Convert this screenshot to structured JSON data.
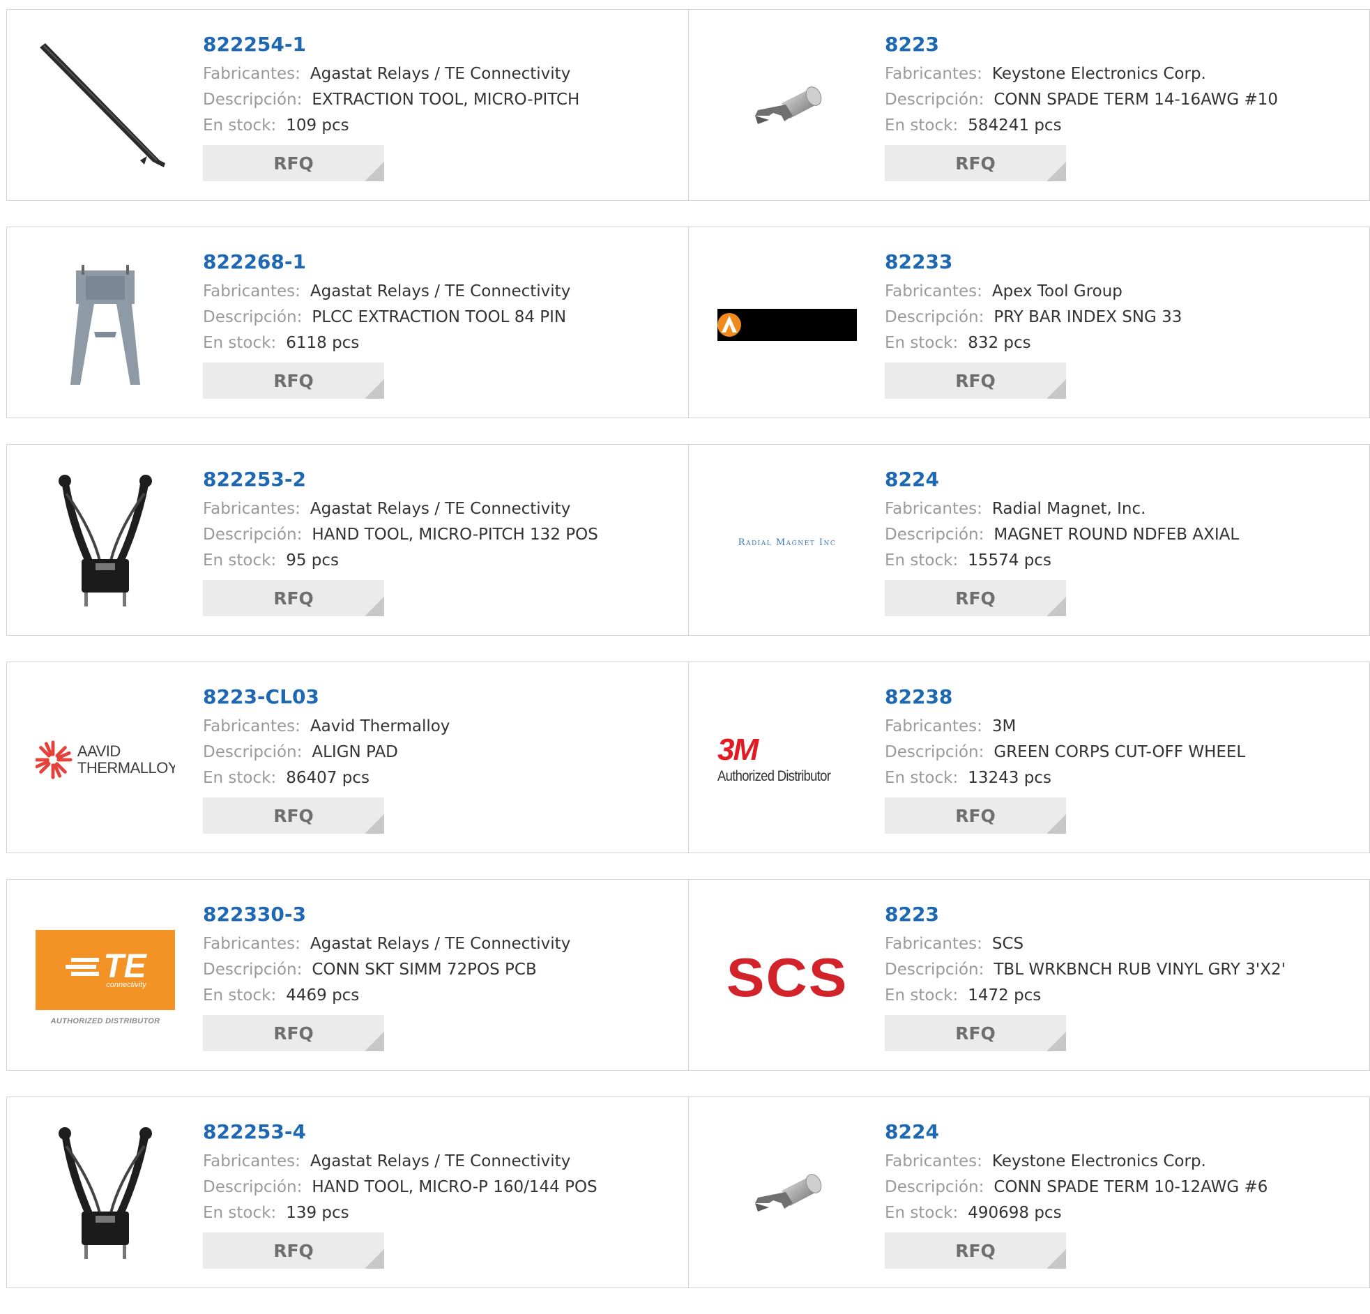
{
  "labels": {
    "manufacturer": "Fabricantes:",
    "description": "Descripción:",
    "stock": "En stock:",
    "rfq": "RFQ"
  },
  "rows": [
    {
      "left": {
        "part": "822254-1",
        "manufacturer": "Agastat Relays / TE Connectivity",
        "description": "EXTRACTION TOOL, MICRO-PITCH",
        "stock": "109 pcs",
        "image": "extraction-tool-image"
      },
      "right": {
        "part": "8223",
        "manufacturer": "Keystone Electronics Corp.",
        "description": "CONN SPADE TERM 14-16AWG #10",
        "stock": "584241 pcs",
        "image": "spade-terminal-image"
      }
    },
    {
      "left": {
        "part": "822268-1",
        "manufacturer": "Agastat Relays / TE Connectivity",
        "description": "PLCC EXTRACTION TOOL 84 PIN",
        "stock": "6118 pcs",
        "image": "plcc-extraction-tool-image"
      },
      "right": {
        "part": "82233",
        "manufacturer": "Apex Tool Group",
        "description": "PRY BAR INDEX SNG 33",
        "stock": "832 pcs",
        "image": "apex-tool-group-logo"
      }
    },
    {
      "left": {
        "part": "822253-2",
        "manufacturer": "Agastat Relays / TE Connectivity",
        "description": "HAND TOOL, MICRO-PITCH 132 POS",
        "stock": "95 pcs",
        "image": "hand-tool-image"
      },
      "right": {
        "part": "8224",
        "manufacturer": "Radial Magnet, Inc.",
        "description": "MAGNET ROUND NDFEB AXIAL",
        "stock": "15574 pcs",
        "image": "radial-magnet-logo",
        "logo_text": "Radial Magnet Inc"
      }
    },
    {
      "left": {
        "part": "8223-CL03",
        "manufacturer": "Aavid Thermalloy",
        "description": "ALIGN PAD",
        "stock": "86407 pcs",
        "image": "aavid-thermalloy-logo",
        "logo_text": [
          "AAVID",
          "THERMALLOY"
        ]
      },
      "right": {
        "part": "82238",
        "manufacturer": "3M",
        "description": "GREEN CORPS CUT-OFF WHEEL",
        "stock": "13243 pcs",
        "image": "3m-authorized-distributor-logo",
        "logo_text": [
          "3M",
          "Authorized Distributor"
        ]
      }
    },
    {
      "left": {
        "part": "822330-3",
        "manufacturer": "Agastat Relays / TE Connectivity",
        "description": "CONN SKT SIMM 72POS PCB",
        "stock": "4469 pcs",
        "image": "te-connectivity-logo",
        "logo_text": [
          "TE",
          "connectivity",
          "AUTHORIZED DISTRIBUTOR"
        ]
      },
      "right": {
        "part": "8223",
        "manufacturer": "SCS",
        "description": "TBL WRKBNCH RUB VINYL GRY 3'X2'",
        "stock": "1472 pcs",
        "image": "scs-logo",
        "logo_text": "SCS"
      }
    },
    {
      "left": {
        "part": "822253-4",
        "manufacturer": "Agastat Relays / TE Connectivity",
        "description": "HAND TOOL, MICRO-P 160/144 POS",
        "stock": "139 pcs",
        "image": "hand-tool-image"
      },
      "right": {
        "part": "8224",
        "manufacturer": "Keystone Electronics Corp.",
        "description": "CONN SPADE TERM 10-12AWG #6",
        "stock": "490698 pcs",
        "image": "spade-terminal-image"
      }
    }
  ],
  "colors": {
    "part_link": "#1d67b3",
    "label": "#9a9a9a",
    "value": "#333333",
    "rfq_bg": "#ebebeb",
    "border": "#d2d2d2",
    "te_orange": "#f39325",
    "scs_red": "#d2232a",
    "threem_red": "#e21b23",
    "aavid_red": "#e5413b"
  }
}
